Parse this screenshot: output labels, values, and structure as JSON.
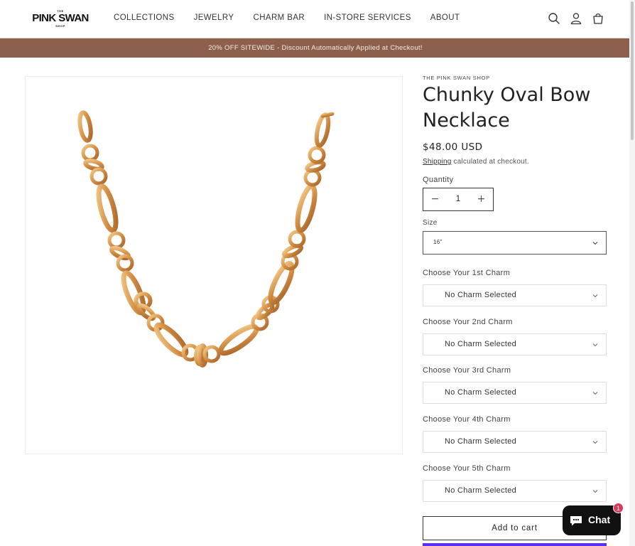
{
  "header": {
    "logo_top": "THE",
    "logo_main": "PINK SWAN",
    "logo_bottom": "SHOP",
    "nav": [
      "COLLECTIONS",
      "JEWELRY",
      "CHARM BAR",
      "IN-STORE SERVICES",
      "ABOUT"
    ],
    "icons": [
      "search-icon",
      "account-icon",
      "cart-icon"
    ]
  },
  "announcement": "20% OFF SITEWIDE - Discount Automatically Applied at Checkout!",
  "product": {
    "vendor": "THE PINK SWAN SHOP",
    "title": "Chunky Oval Bow Necklace",
    "price": "$48.00 USD",
    "shipping_link": "Shipping",
    "shipping_text": " calculated at checkout.",
    "quantity_label": "Quantity",
    "quantity_minus": "−",
    "quantity_value": "1",
    "quantity_plus": "+",
    "size_label": "Size",
    "size_value": "16\"",
    "charms": [
      {
        "label": "Choose Your 1st Charm",
        "value": "No Charm Selected"
      },
      {
        "label": "Choose Your 2nd Charm",
        "value": "No Charm Selected"
      },
      {
        "label": "Choose Your 3rd Charm",
        "value": "No Charm Selected"
      },
      {
        "label": "Choose Your 4th Charm",
        "value": "No Charm Selected"
      },
      {
        "label": "Choose Your 5th Charm",
        "value": "No Charm Selected"
      }
    ],
    "add_to_cart": "Add to cart"
  },
  "chat": {
    "label": "Chat",
    "badge": "1"
  },
  "colors": {
    "announcement_bg": "#8c604c",
    "gold": "#d69a52",
    "chat_bg": "#111111",
    "badge_bg": "#d63a5c",
    "shop_pay": "#5a31f4"
  }
}
